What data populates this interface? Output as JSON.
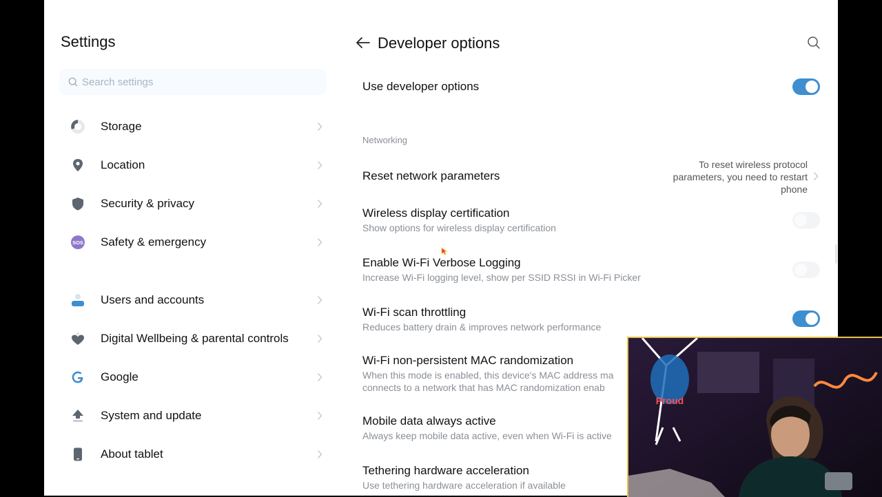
{
  "settings_panel": {
    "title": "Settings",
    "search_placeholder": "Search settings",
    "items": [
      {
        "label": "Storage",
        "icon": "storage-icon"
      },
      {
        "label": "Location",
        "icon": "location-pin-icon"
      },
      {
        "label": "Security & privacy",
        "icon": "shield-icon"
      },
      {
        "label": "Safety & emergency",
        "icon": "sos-icon"
      },
      {
        "label": "Users and accounts",
        "icon": "user-icon"
      },
      {
        "label": "Digital Wellbeing & parental controls",
        "icon": "heart-icon"
      },
      {
        "label": "Google",
        "icon": "google-icon"
      },
      {
        "label": "System and update",
        "icon": "update-arrow-icon"
      },
      {
        "label": "About tablet",
        "icon": "tablet-icon"
      }
    ]
  },
  "developer_options": {
    "title": "Developer options",
    "use_developer_options": {
      "label": "Use developer options",
      "enabled": true
    },
    "section_networking": "Networking",
    "reset_network": {
      "label": "Reset network parameters",
      "description": "To reset wireless protocol parameters, you need to restart phone"
    },
    "settings": [
      {
        "label": "Wireless display certification",
        "sub": "Show options for wireless display certification",
        "enabled": false
      },
      {
        "label": "Enable Wi-Fi Verbose Logging",
        "sub": "Increase Wi-Fi logging level, show per SSID RSSI in Wi-Fi Picker",
        "enabled": false
      },
      {
        "label": "Wi-Fi scan throttling",
        "sub": "Reduces battery drain & improves network performance",
        "enabled": true
      },
      {
        "label": "Wi-Fi non-persistent MAC randomization",
        "sub": "When this mode is enabled, this device's MAC address ma",
        "sub2": "connects to a network that has MAC randomization enab"
      },
      {
        "label": "Mobile data always active",
        "sub": "Always keep mobile data active, even when Wi-Fi is active"
      },
      {
        "label": "Tethering hardware acceleration",
        "sub": "Use tethering hardware acceleration if available"
      }
    ]
  },
  "colors": {
    "toggle_on": "#3f8ed0",
    "accent": "#3f8ed0",
    "secondary_text": "#8a8f96"
  }
}
